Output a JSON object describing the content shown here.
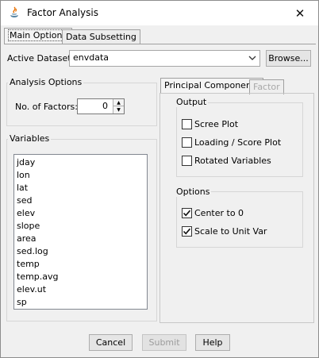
{
  "window": {
    "title": "Factor Analysis"
  },
  "tabs": {
    "main_options": "Main Options",
    "data_subsetting": "Data Subsetting"
  },
  "active_dataset": {
    "label": "Active Dataset:",
    "value": "envdata",
    "browse": "Browse..."
  },
  "analysis_options": {
    "title": "Analysis Options",
    "factors_label": "No. of Factors:",
    "factors_value": "0"
  },
  "variables": {
    "title": "Variables",
    "items": [
      "jday",
      "lon",
      "lat",
      "sed",
      "elev",
      "slope",
      "area",
      "sed.log",
      "temp",
      "temp.avg",
      "elev.ut",
      "sp"
    ]
  },
  "subtabs": {
    "principal_components": "Principal Components",
    "factor": "Factor"
  },
  "output": {
    "title": "Output",
    "scree_plot": {
      "label": "Scree Plot",
      "checked": false
    },
    "loading_score_plot": {
      "label": "Loading / Score Plot",
      "checked": false
    },
    "rotated_variables": {
      "label": "Rotated Variables",
      "checked": false
    }
  },
  "options": {
    "title": "Options",
    "center_to_0": {
      "label": "Center to 0",
      "checked": true
    },
    "scale_to_unit_var": {
      "label": "Scale to Unit Var",
      "checked": true
    }
  },
  "buttons": {
    "cancel": "Cancel",
    "submit": "Submit",
    "help": "Help"
  }
}
